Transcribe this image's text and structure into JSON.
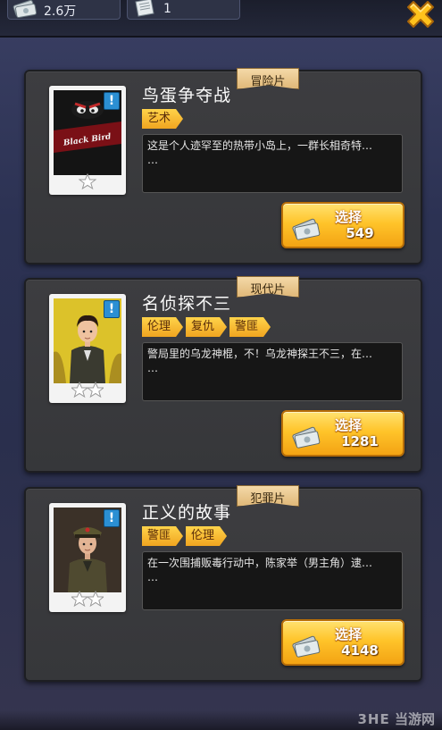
{
  "resources": {
    "money": "2.6万",
    "scripts": "1"
  },
  "cards": [
    {
      "genre": "冒险片",
      "title": "鸟蛋争夺战",
      "tags": [
        "艺术"
      ],
      "description": "这是个人迹罕至的热带小岛上，一群长相奇特…",
      "description_more": "…",
      "select_label": "选择",
      "cost": "549",
      "poster_text": "Black Bird"
    },
    {
      "genre": "现代片",
      "title": "名侦探不三",
      "tags": [
        "伦理",
        "复仇",
        "警匪"
      ],
      "description": "警局里的乌龙神棍，不！乌龙神探王不三，在…",
      "description_more": "…",
      "select_label": "选择",
      "cost": "1281"
    },
    {
      "genre": "犯罪片",
      "title": "正义的故事",
      "tags": [
        "警匪",
        "伦理"
      ],
      "description": "在一次围捕贩毒行动中，陈家举（男主角）逮…",
      "description_more": "…",
      "select_label": "选择",
      "cost": "4148"
    }
  ],
  "watermark": {
    "logo": "3HE",
    "site": "当游网"
  }
}
